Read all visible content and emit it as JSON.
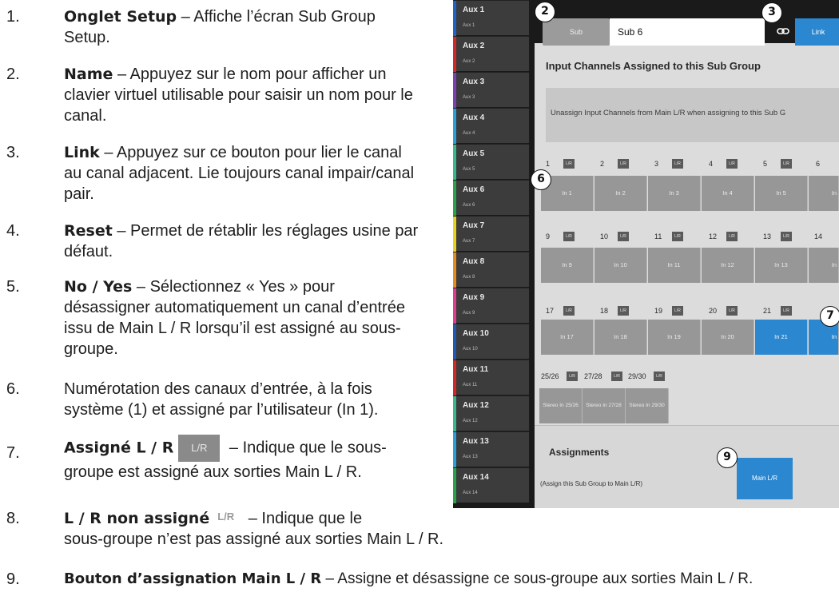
{
  "doc": {
    "items": [
      {
        "num": "1.",
        "term": "Onglet Setup",
        "line1": " – Affiche l’écran Sub Group",
        "line2": "Setup."
      },
      {
        "num": "2.",
        "term": "Name",
        "line1": " – Appuyez sur le nom pour afficher un",
        "line2": "clavier virtuel utilisable pour saisir un nom pour le",
        "line3": "canal."
      },
      {
        "num": "3.",
        "term": "Link",
        "line1": " – Appuyez sur ce bouton pour lier le canal",
        "line2": "au canal adjacent. Lie toujours canal impair/canal",
        "line3": "pair."
      },
      {
        "num": "4.",
        "term": "Reset",
        "line1": " – Permet de rétablir les réglages usine par",
        "line2": "défaut."
      },
      {
        "num": "5.",
        "term": "No / Yes",
        "line1": " – Sélectionnez « Yes » pour",
        "line2": "désassigner automatiquement un canal d’entrée",
        "line3": "issu de Main L / R lorsqu’il est assigné au sous-",
        "line4": "groupe."
      },
      {
        "num": "6.",
        "term": "",
        "line1": "Numérotation des canaux d’entrée, à la fois",
        "line2": "système (1) et assigné par l’utilisateur (In 1)."
      },
      {
        "num": "7.",
        "term": "Assigné L / R",
        "chip": "L/R",
        "line1": " – Indique que le sous-",
        "line2": "groupe est assigné aux sorties Main L / R."
      },
      {
        "num": "8.",
        "term": "L / R non assigné",
        "chip": "L/R",
        "line1": " – Indique que le",
        "line2": "sous-groupe n’est pas assigné aux sorties Main L / R."
      },
      {
        "num": "9.",
        "term": "Bouton d’assignation Main L / R",
        "line1": " – Assigne et désassigne ce sous-groupe aux sorties Main L / R."
      }
    ]
  },
  "aux": [
    {
      "big": "Aux 1",
      "small": "Aux 1",
      "color": "#1e64c8"
    },
    {
      "big": "Aux 2",
      "small": "Aux 2",
      "color": "#d22828"
    },
    {
      "big": "Aux 3",
      "small": "Aux 3",
      "color": "#7c3fb4"
    },
    {
      "big": "Aux 4",
      "small": "Aux 4",
      "color": "#2aa0d8"
    },
    {
      "big": "Aux 5",
      "small": "Aux 5",
      "color": "#37b98c"
    },
    {
      "big": "Aux 6",
      "small": "Aux 6",
      "color": "#2aa24a"
    },
    {
      "big": "Aux 7",
      "small": "Aux 7",
      "color": "#e6d21e"
    },
    {
      "big": "Aux 8",
      "small": "Aux 8",
      "color": "#e68c1e"
    },
    {
      "big": "Aux 9",
      "small": "Aux 9",
      "color": "#e03c8c"
    },
    {
      "big": "Aux 10",
      "small": "Aux 10",
      "color": "#1e5ab4"
    },
    {
      "big": "Aux 11",
      "small": "Aux 11",
      "color": "#d22828"
    },
    {
      "big": "Aux 12",
      "small": "Aux 12",
      "color": "#37b98c"
    },
    {
      "big": "Aux 13",
      "small": "Aux 13",
      "color": "#2aa0d8"
    },
    {
      "big": "Aux 14",
      "small": "Aux 14",
      "color": "#2aa24a"
    }
  ],
  "screen": {
    "sub_label": "Sub",
    "name_value": "Sub 6",
    "link_label": "Link",
    "title": "Input Channels Assigned to this Sub Group",
    "unassign_text": "Unassign Input Channels from Main L/R when assigning to this Sub G",
    "lr_tag": "L/R",
    "rows": [
      {
        "labels": [
          "1",
          "2",
          "3",
          "4",
          "5",
          "6"
        ],
        "buttons": [
          "In 1",
          "In 2",
          "In 3",
          "In 4",
          "In 5",
          "In"
        ]
      },
      {
        "labels": [
          "9",
          "10",
          "11",
          "12",
          "13",
          "14"
        ],
        "buttons": [
          "In 9",
          "In 10",
          "In 11",
          "In 12",
          "In 13",
          "In"
        ]
      },
      {
        "labels": [
          "17",
          "18",
          "19",
          "20",
          "21",
          ""
        ],
        "buttons": [
          "In 17",
          "In 18",
          "In 19",
          "In 20",
          "In 21",
          "In"
        ],
        "active": [
          4,
          5
        ]
      }
    ],
    "stereo": {
      "labels": [
        "25/26",
        "27/28",
        "29/30"
      ],
      "buttons": [
        "Stereo In 25/26",
        "Stereo In 27/28",
        "Stereo In 29/30"
      ]
    },
    "assignments_title": "Assignments",
    "assign_note": "(Assign this Sub Group to Main L/R)",
    "main_lr_label": "Main L/R",
    "callouts": [
      "2",
      "3",
      "6",
      "7",
      "9"
    ]
  }
}
